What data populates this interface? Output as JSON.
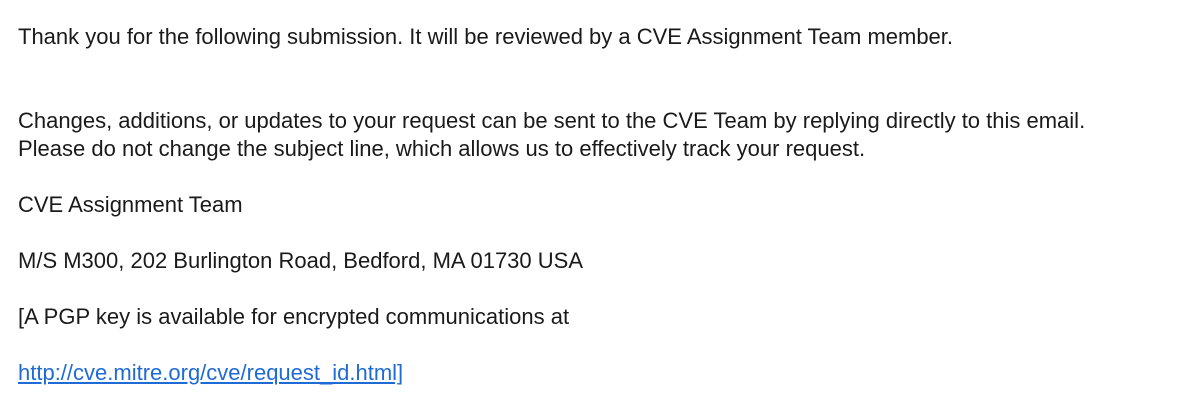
{
  "email": {
    "intro": "Thank you for the following submission. It will be reviewed by a CVE Assignment Team member.",
    "changes_line1": "Changes, additions, or updates to your request can be sent to the CVE Team by replying directly to this email.",
    "changes_line2": "Please do not change the subject line, which allows us to effectively track your request.",
    "team_name": "CVE Assignment Team",
    "address": "M/S M300, 202 Burlington Road, Bedford, MA 01730 USA",
    "pgp_text": "[A PGP key is available for encrypted communications at",
    "pgp_link_text": "http://cve.mitre.org/cve/request_id.html]",
    "pgp_link_href": "http://cve.mitre.org/cve/request_id.html"
  }
}
